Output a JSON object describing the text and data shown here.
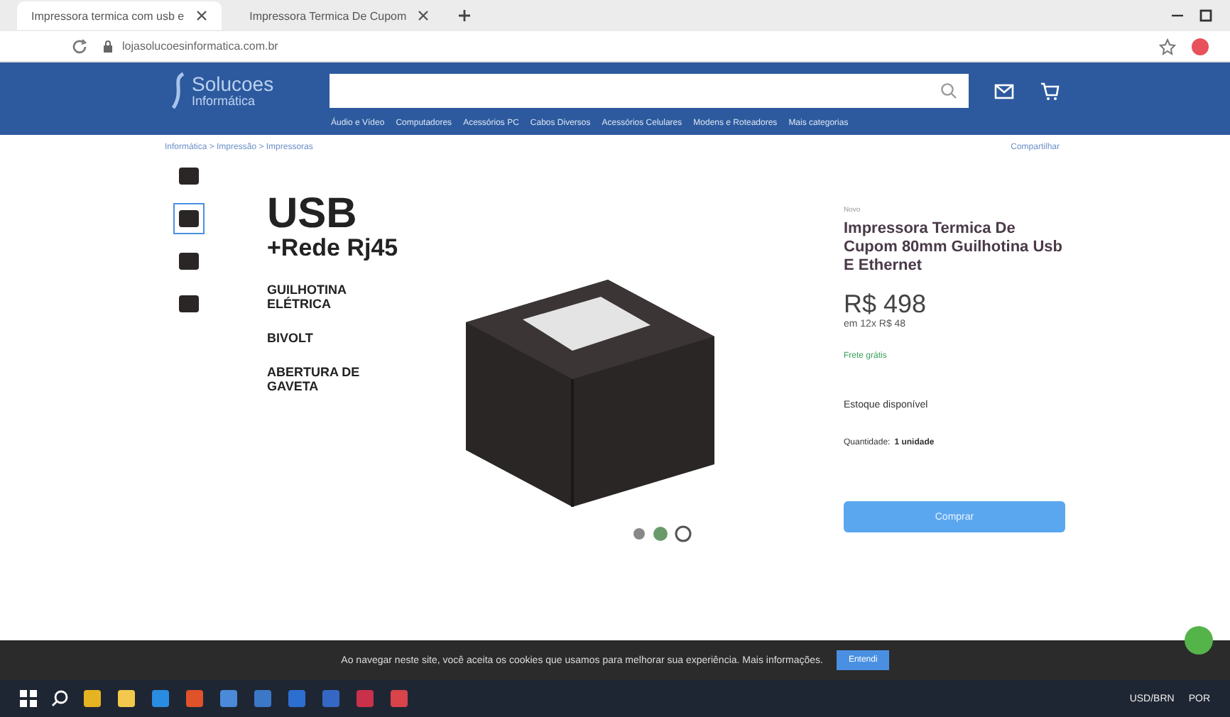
{
  "browser": {
    "tabs": [
      {
        "title": "Impressora termica com usb e",
        "selected": true
      },
      {
        "title": "Impressora Termica De Cupom",
        "selected": false
      }
    ],
    "url": "lojasolucoesinformatica.com.br"
  },
  "header": {
    "logo_line1": "Solucoes",
    "logo_line2": "Informática",
    "categories": [
      "Áudio e Vídeo",
      "Computadores",
      "Acessórios PC",
      "Cabos Diversos",
      "Acessórios Celulares",
      "Modens e Roteadores",
      "Mais categorias"
    ]
  },
  "breadcrumb": "Informática > Impressão > Impressoras",
  "share": "Compartilhar",
  "gallery": {
    "thumbnails": [
      {
        "selected": false
      },
      {
        "selected": true
      },
      {
        "selected": false
      },
      {
        "selected": false
      }
    ],
    "image_texts": [
      "USB",
      "+Rede Rj45",
      "GUILHOTINA ELÉTRICA",
      "BIVOLT",
      "ABERTURA DE GAVETA"
    ]
  },
  "product": {
    "condition": "Novo",
    "title": "Impressora Termica De Cupom 80mm Guilhotina Usb E Ethernet",
    "price": "R$ 498",
    "installments": "em 12x R$ 48",
    "shipping": "Frete grátis",
    "stock": "Estoque disponível",
    "quantity_label": "Quantidade:",
    "quantity": "1 unidade",
    "buy_button": "Comprar"
  },
  "cookie_bar": {
    "text": "Ao navegar neste site, você aceita os cookies que usamos para melhorar sua experiência. Mais informações.",
    "button": "Entendi"
  },
  "taskbar": {
    "ticker": "USD/BRN",
    "language": "POR"
  }
}
